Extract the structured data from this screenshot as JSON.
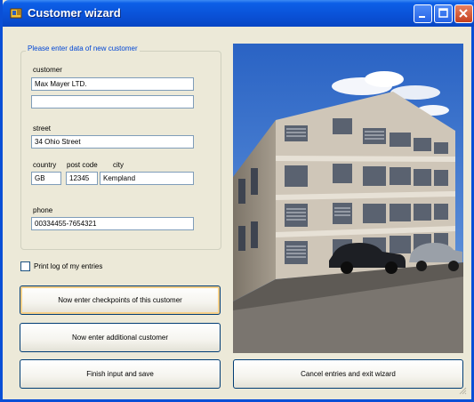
{
  "window": {
    "title": "Customer wizard"
  },
  "titlebar_buttons": [
    "minimize-icon",
    "maximize-icon",
    "close-icon"
  ],
  "form": {
    "group_title": "Please enter data of new customer",
    "customer_label": "customer",
    "customer_line1": "Max Mayer LTD.",
    "customer_line2": "",
    "street_label": "street",
    "street_value": "34 Ohio Street",
    "country_label": "country",
    "postcode_label": "post code",
    "city_label": "city",
    "country_value": "GB",
    "postcode_value": "12345",
    "city_value": "Kempland",
    "phone_label": "phone",
    "phone_value": "00334455-7654321"
  },
  "print_log": {
    "label": "Print log of my entries",
    "checked": false
  },
  "buttons": {
    "checkpoints": "Now enter checkpoints of this customer",
    "additional": "Now enter additional customer",
    "finish": "Finish input and save",
    "cancel": "Cancel entries and exit wizard"
  },
  "colors": {
    "titlebar": "#0a52d8",
    "accent": "#0046d5",
    "background": "#ece9d8"
  }
}
